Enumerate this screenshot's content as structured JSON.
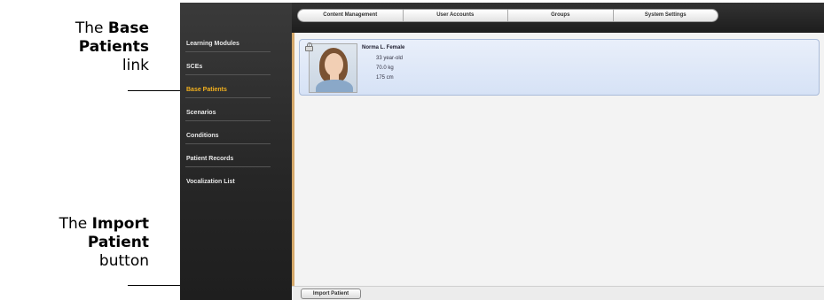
{
  "callouts": {
    "base_patients": {
      "pre": "The ",
      "bold": "Base Patients",
      "post": "link"
    },
    "import_patient": {
      "pre": "The ",
      "bold": "Import Patient",
      "post": "button"
    }
  },
  "topbar": {
    "tabs": [
      "Content Management",
      "User Accounts",
      "Groups",
      "System Settings"
    ]
  },
  "sidebar": {
    "items": [
      {
        "label": "Learning Modules"
      },
      {
        "label": "SCEs"
      },
      {
        "label": "Base Patients"
      },
      {
        "label": "Scenarios"
      },
      {
        "label": "Conditions"
      },
      {
        "label": "Patient Records"
      },
      {
        "label": "Vocalization List"
      }
    ],
    "active_index": 2
  },
  "patient": {
    "name": "Norma L. Female",
    "age": "33 year-old",
    "weight": "70.0 kg",
    "height": "175 cm"
  },
  "bottombar": {
    "import_label": "Import Patient"
  },
  "colors": {
    "active_nav": "#f2b01e",
    "card_bg": "#d6e2f6",
    "card_border": "#a9bbd9"
  },
  "icons": {
    "lock": "lock-icon"
  }
}
